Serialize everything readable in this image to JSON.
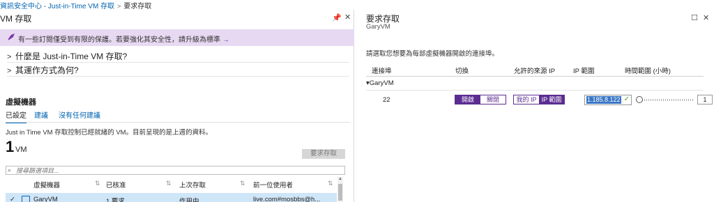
{
  "breadcrumb": {
    "item1": "資訊安全中心 - Just-in-Time VM 存取",
    "sep": ">",
    "item2": "要求存取"
  },
  "left": {
    "title": "VM 存取",
    "pin_icon": "pin-icon",
    "close_icon": "close-icon",
    "banner": {
      "icon": "rocket-icon",
      "text": "有一些訂閱僅受到有限的保護。若要強化其安全性，請升級為標準",
      "arrow": "→"
    },
    "faq": [
      {
        "chevron": ">",
        "label": "什麼是 Just-in-Time VM 存取?"
      },
      {
        "chevron": ">",
        "label": "其運作方式為何?"
      }
    ],
    "section_title": "虛擬機器",
    "tabs": [
      "已設定",
      "建議",
      "沒有任何建議"
    ],
    "description": "Just in Time VM 存取控制已經就緒的 VM。目前呈現的是上週的資料。",
    "count": "1",
    "count_unit": "VM",
    "request_button": "要求存取",
    "search_placeholder": "搜尋篩選項目...",
    "columns": [
      "虛擬機器",
      "已核准",
      "上次存取",
      "前一位使用者"
    ],
    "sort_glyph": "⇅",
    "rows": [
      {
        "check": "✓",
        "vm": "GaryVM",
        "approved": "1 要求",
        "last_access": "作用中",
        "last_user": "live.com#mosbbs@h..."
      }
    ]
  },
  "right": {
    "title": "要求存取",
    "subtitle": "GaryVM",
    "maximize_icon": "☐",
    "close_icon": "✕",
    "description": "請選取您想要為每部虛擬機器開啟的連接埠。",
    "columns": [
      "連接埠",
      "切換",
      "允許的來源 IP",
      "IP 範圍",
      "時間範圍 (小時)"
    ],
    "group": {
      "caret": "▾",
      "label": "GaryVM"
    },
    "row": {
      "port": "22",
      "toggle_on": "開啟",
      "toggle_off": "關閉",
      "source_my_ip": "我的 IP",
      "source_ip_range": "IP 範圍",
      "ip_value": "1.185.8.122",
      "hours": "1"
    }
  },
  "colors": {
    "accent_purple": "#5c2d91",
    "link_blue": "#0063b1",
    "banner_bg": "#e8d9f2",
    "selected_row": "#cfe5f8"
  }
}
